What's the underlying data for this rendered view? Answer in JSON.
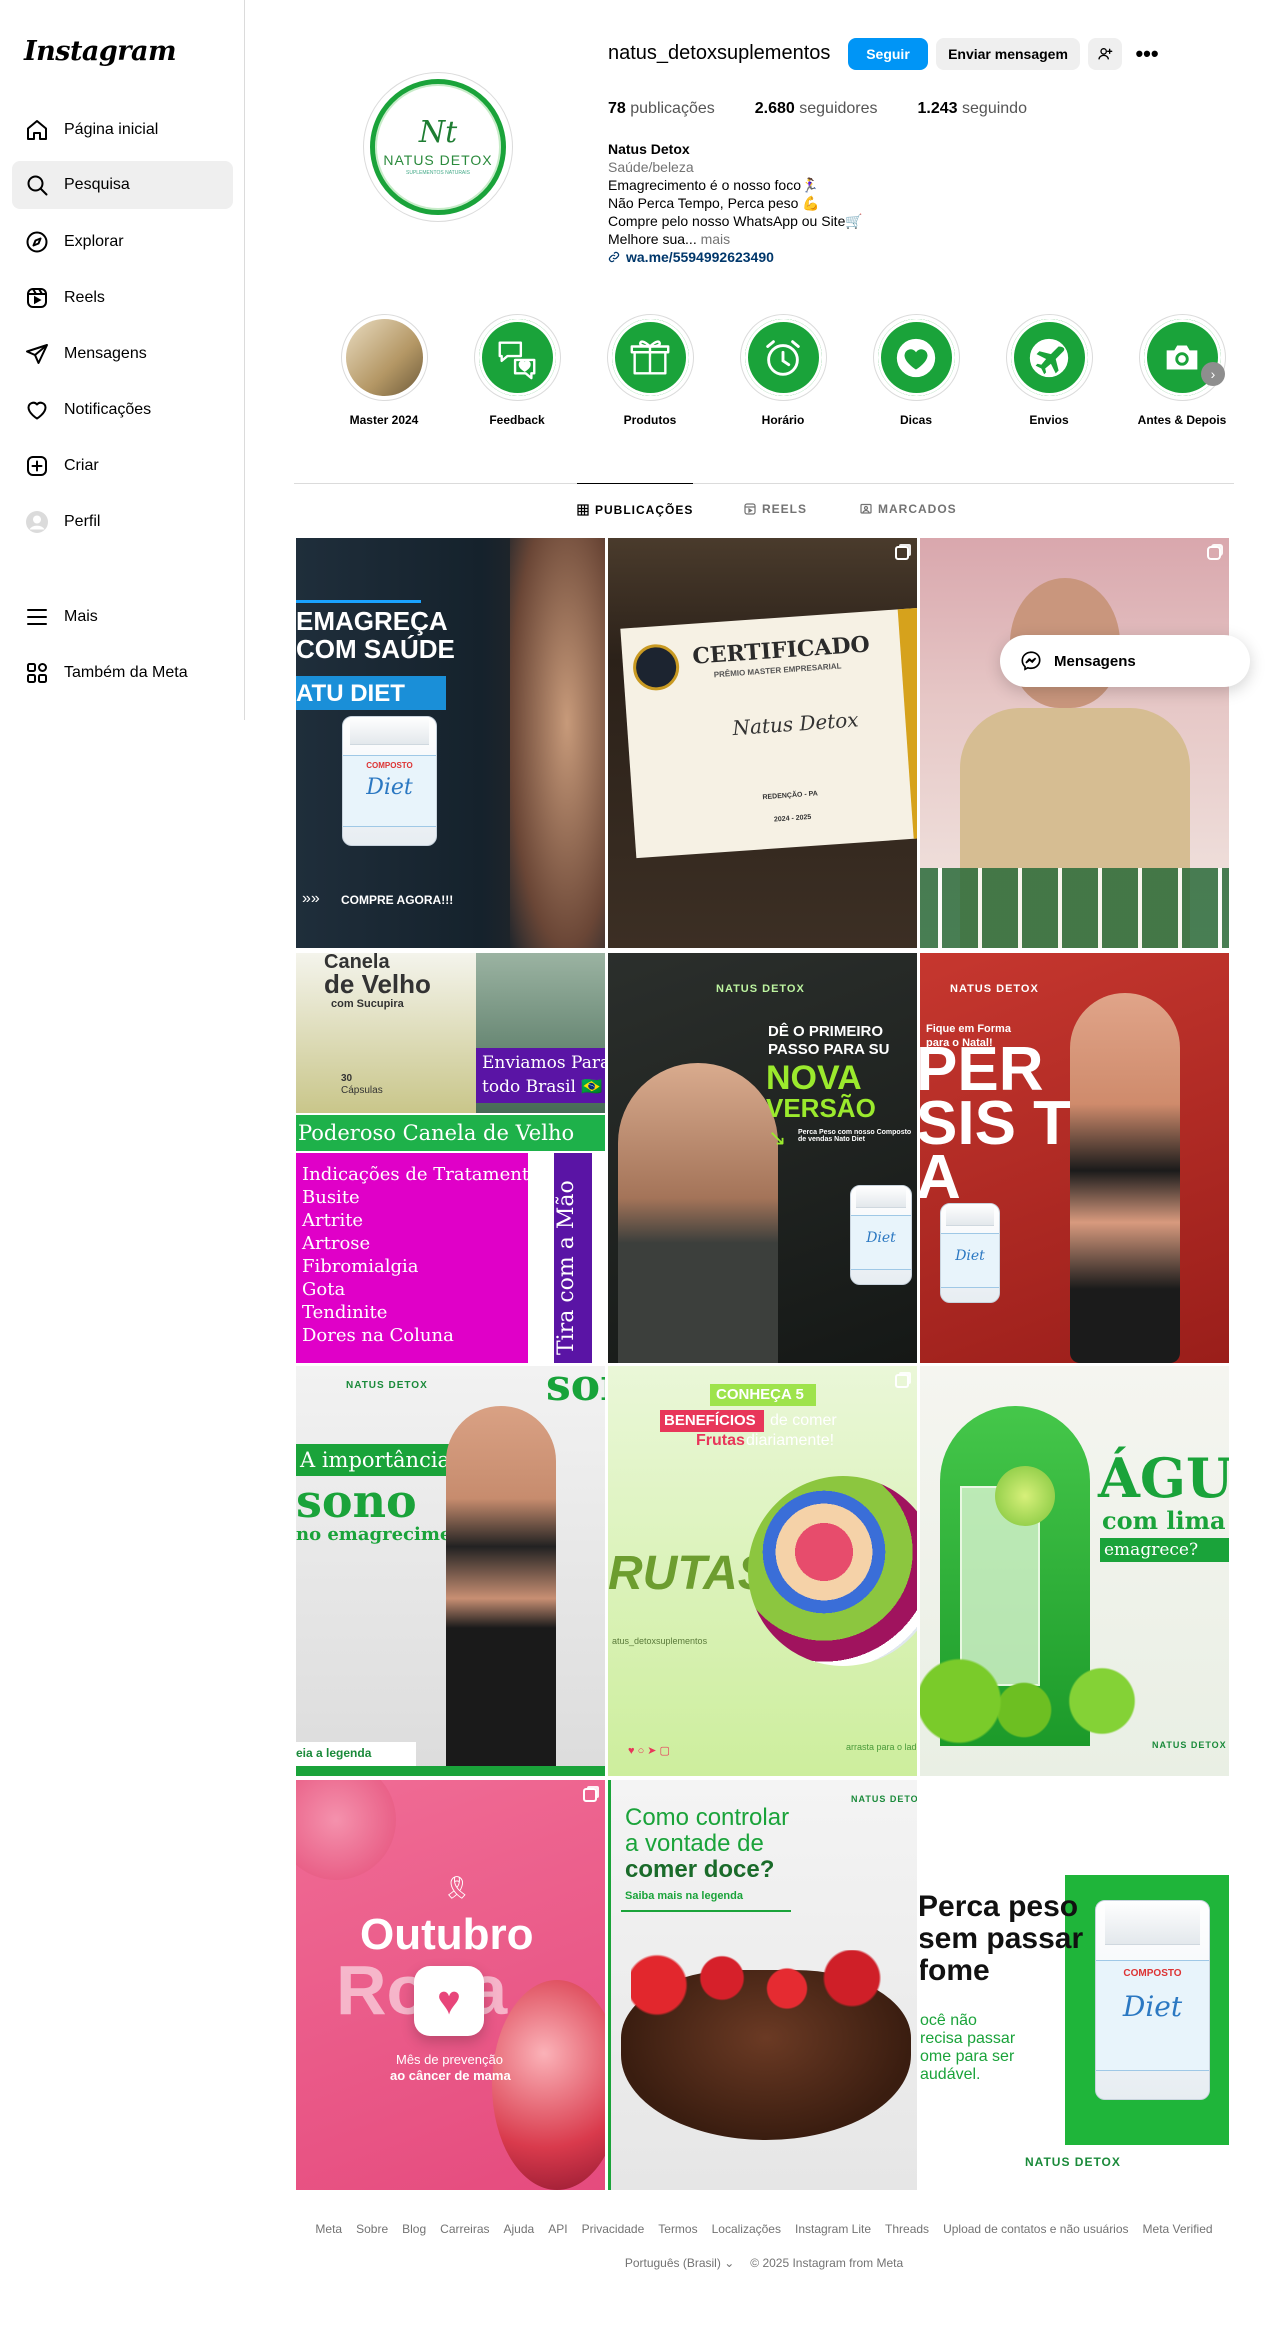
{
  "app": {
    "logo": "Instagram"
  },
  "sidebar": {
    "items": [
      {
        "label": "Página inicial",
        "icon": "home-icon"
      },
      {
        "label": "Pesquisa",
        "icon": "search-icon"
      },
      {
        "label": "Explorar",
        "icon": "compass-icon"
      },
      {
        "label": "Reels",
        "icon": "reels-icon"
      },
      {
        "label": "Mensagens",
        "icon": "send-icon"
      },
      {
        "label": "Notificações",
        "icon": "heart-icon"
      },
      {
        "label": "Criar",
        "icon": "plus-square-icon"
      },
      {
        "label": "Perfil",
        "icon": "profile-avatar"
      },
      {
        "label": "Mais",
        "icon": "menu-icon"
      },
      {
        "label": "Também da Meta",
        "icon": "meta-apps-icon"
      }
    ]
  },
  "profile": {
    "avatar_mark": "Nt",
    "avatar_name": "NATUS DETOX",
    "avatar_sub": "SUPLEMENTOS NATURAIS",
    "username": "natus_detoxsuplementos",
    "follow_label": "Seguir",
    "message_label": "Enviar mensagem",
    "more_label": "•••",
    "stats": {
      "posts_count": "78",
      "posts_label": "publicações",
      "followers_count": "2.680",
      "followers_label": "seguidores",
      "following_count": "1.243",
      "following_label": "seguindo"
    },
    "bio": {
      "name": "Natus Detox",
      "category": "Saúde/beleza",
      "line1": "Emagrecimento é o nosso foco🏃‍♀️",
      "line2": "Não Perca Tempo, Perca peso 💪",
      "line3": "Compre pelo nosso WhatsApp ou Site🛒",
      "line4": "Melhore sua...",
      "more": "mais",
      "link": "wa.me/5594992623490"
    }
  },
  "highlights": [
    {
      "label": "Master 2024",
      "icon": "certificate-photo"
    },
    {
      "label": "Feedback",
      "icon": "chat-heart-icon"
    },
    {
      "label": "Produtos",
      "icon": "box-icon"
    },
    {
      "label": "Horário",
      "icon": "alarm-clock-icon"
    },
    {
      "label": "Dicas",
      "icon": "heart-icon"
    },
    {
      "label": "Envios",
      "icon": "airplane-icon"
    },
    {
      "label": "Antes & Depois",
      "icon": "camera-icon"
    }
  ],
  "tabs": [
    {
      "label": "PUBLICAÇÕES",
      "icon": "grid-icon",
      "active": true
    },
    {
      "label": "REELS",
      "icon": "reels-icon",
      "active": false
    },
    {
      "label": "MARCADOS",
      "icon": "tag-icon",
      "active": false
    }
  ],
  "posts": {
    "p1": {
      "l1": "EMAGREÇA",
      "l2": "COM SAÚDE",
      "l3": "ATU DIET",
      "cta": "COMPRE AGORA!!!",
      "jar_top": "COMPOSTO",
      "jar_brand": "Diet"
    },
    "p2": {
      "title": "CERTIFICADO",
      "sub": "PRÊMIO MASTER EMPRESARIAL",
      "name": "Natus Detox",
      "city": "REDENÇÃO - PA",
      "years": "2024 - 2025"
    },
    "p4": {
      "t1": "Canela",
      "t2": "de Velho",
      "t3": "com Sucupira",
      "t4": "30",
      "t5": "Cápsulas",
      "ship1": "Enviamos Para",
      "ship2": "todo Brasil 🇧🇷",
      "banner": "Poderoso Canela de Velho",
      "side": "Tira com a Mão",
      "list": [
        "Indicações de Tratamento",
        "Busite",
        "Artrite",
        "Artrose",
        "Fibromialgia",
        "Gota",
        "Tendinite",
        "Dores na Coluna"
      ]
    },
    "p5": {
      "brand": "NATUS DETOX",
      "l1": "DÊ O PRIMEIRO",
      "l2": "PASSO PARA SU",
      "l3": "NOVA",
      "l4": "VERSÃO",
      "small": "Perca Peso com nosso Composto de vendas Nato Diet"
    },
    "p6": {
      "brand": "NATUS DETOX",
      "l1": "Fique em Forma",
      "l2": "para o Natal!",
      "big": "PER SIS TA"
    },
    "p7": {
      "brand": "NATUS DETOX",
      "l1": "A importância do",
      "l2": "sono",
      "l3": "no emagrecimento",
      "cta": "eia a legenda",
      "bg": "son"
    },
    "p8": {
      "l1": "CONHEÇA 5",
      "l2": "BENEFÍCIOS",
      "l3": "de comer",
      "l4": "Frutas",
      "l5": "diariamente!",
      "big": "RUTAS",
      "handle": "atus_detoxsuplementos",
      "footer": "arrasta para o lado"
    },
    "p9": {
      "l1": "ÁGU",
      "l2": "com lima",
      "l3": "emagrece?",
      "brand": "NATUS DETOX"
    },
    "p10": {
      "l1": "Outubro",
      "l2": "Rosa",
      "l3": "Mês de prevenção",
      "l4": "ao câncer de mama"
    },
    "p11": {
      "brand": "NATUS DETOX",
      "l1": "Como controlar",
      "l2": "a vontade de",
      "l3": "comer doce?",
      "l4": "Saiba mais na legenda"
    },
    "p12": {
      "l1": "Perca peso",
      "l2": "sem passar",
      "l3": "fome",
      "l4": "ocê não",
      "l5": "recisa passar",
      "l6": "ome para ser",
      "l7": "audável.",
      "jar_top": "COMPOSTO",
      "jar_brand": "Diet",
      "brand": "NATUS DETOX"
    }
  },
  "floating_messages": {
    "label": "Mensagens"
  },
  "footer": {
    "links": [
      "Meta",
      "Sobre",
      "Blog",
      "Carreiras",
      "Ajuda",
      "API",
      "Privacidade",
      "Termos",
      "Localizações",
      "Instagram Lite",
      "Threads",
      "Upload de contatos e não usuários",
      "Meta Verified"
    ],
    "language": "Português (Brasil)",
    "copyright": "© 2025 Instagram from Meta"
  },
  "colors": {
    "accent": "#0095f6",
    "brand_green": "#1aa33a",
    "link": "#00376b"
  }
}
